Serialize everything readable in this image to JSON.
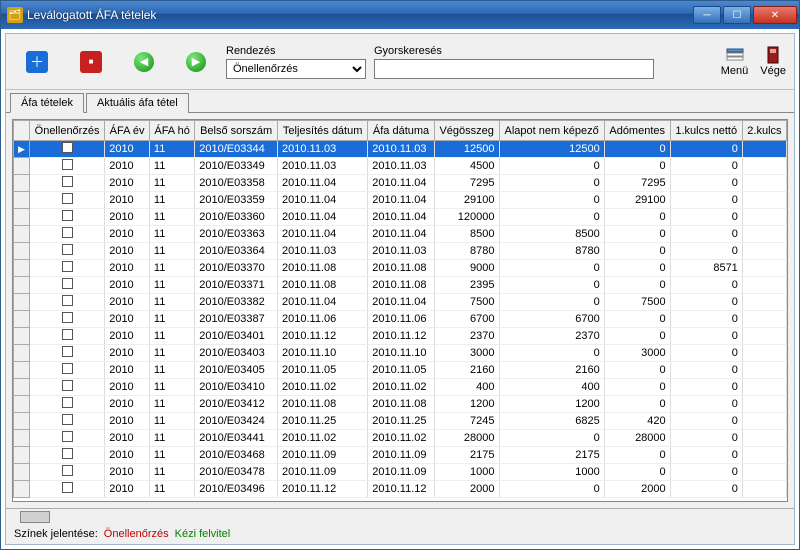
{
  "window": {
    "title": "Leválogatott ÁFA tételek"
  },
  "toolbar": {
    "sort_label": "Rendezés",
    "sort_value": "Önellenőrzés",
    "search_label": "Gyorskeresés",
    "search_value": "",
    "menu": "Menü",
    "end": "Vége"
  },
  "tabs": {
    "items": [
      "Áfa tételek",
      "Aktuális áfa tétel"
    ],
    "active": 0
  },
  "grid": {
    "columns": [
      "Önellenőrzés",
      "ÁFA év",
      "ÁFA hó",
      "Belső sorszám",
      "Teljesítés dátum",
      "Áfa dátuma",
      "Végösszeg",
      "Alapot nem képező",
      "Adómentes",
      "1.kulcs nettó",
      "2.kulcs"
    ],
    "rows": [
      {
        "sel": true,
        "ev": "2010",
        "ho": "11",
        "bs": "2010/E03344",
        "td": "2010.11.03",
        "ad": "2010.11.03",
        "vo": "12500",
        "ank": "12500",
        "am": "0",
        "k1": "0"
      },
      {
        "ev": "2010",
        "ho": "11",
        "bs": "2010/E03349",
        "td": "2010.11.03",
        "ad": "2010.11.03",
        "vo": "4500",
        "ank": "0",
        "am": "0",
        "k1": "0"
      },
      {
        "ev": "2010",
        "ho": "11",
        "bs": "2010/E03358",
        "td": "2010.11.04",
        "ad": "2010.11.04",
        "vo": "7295",
        "ank": "0",
        "am": "7295",
        "k1": "0"
      },
      {
        "ev": "2010",
        "ho": "11",
        "bs": "2010/E03359",
        "td": "2010.11.04",
        "ad": "2010.11.04",
        "vo": "29100",
        "ank": "0",
        "am": "29100",
        "k1": "0"
      },
      {
        "ev": "2010",
        "ho": "11",
        "bs": "2010/E03360",
        "td": "2010.11.04",
        "ad": "2010.11.04",
        "vo": "120000",
        "ank": "0",
        "am": "0",
        "k1": "0"
      },
      {
        "ev": "2010",
        "ho": "11",
        "bs": "2010/E03363",
        "td": "2010.11.04",
        "ad": "2010.11.04",
        "vo": "8500",
        "ank": "8500",
        "am": "0",
        "k1": "0"
      },
      {
        "ev": "2010",
        "ho": "11",
        "bs": "2010/E03364",
        "td": "2010.11.03",
        "ad": "2010.11.03",
        "vo": "8780",
        "ank": "8780",
        "am": "0",
        "k1": "0"
      },
      {
        "ev": "2010",
        "ho": "11",
        "bs": "2010/E03370",
        "td": "2010.11.08",
        "ad": "2010.11.08",
        "vo": "9000",
        "ank": "0",
        "am": "0",
        "k1": "8571"
      },
      {
        "ev": "2010",
        "ho": "11",
        "bs": "2010/E03371",
        "td": "2010.11.08",
        "ad": "2010.11.08",
        "vo": "2395",
        "ank": "0",
        "am": "0",
        "k1": "0"
      },
      {
        "ev": "2010",
        "ho": "11",
        "bs": "2010/E03382",
        "td": "2010.11.04",
        "ad": "2010.11.04",
        "vo": "7500",
        "ank": "0",
        "am": "7500",
        "k1": "0"
      },
      {
        "ev": "2010",
        "ho": "11",
        "bs": "2010/E03387",
        "td": "2010.11.06",
        "ad": "2010.11.06",
        "vo": "6700",
        "ank": "6700",
        "am": "0",
        "k1": "0"
      },
      {
        "ev": "2010",
        "ho": "11",
        "bs": "2010/E03401",
        "td": "2010.11.12",
        "ad": "2010.11.12",
        "vo": "2370",
        "ank": "2370",
        "am": "0",
        "k1": "0"
      },
      {
        "ev": "2010",
        "ho": "11",
        "bs": "2010/E03403",
        "td": "2010.11.10",
        "ad": "2010.11.10",
        "vo": "3000",
        "ank": "0",
        "am": "3000",
        "k1": "0"
      },
      {
        "ev": "2010",
        "ho": "11",
        "bs": "2010/E03405",
        "td": "2010.11.05",
        "ad": "2010.11.05",
        "vo": "2160",
        "ank": "2160",
        "am": "0",
        "k1": "0"
      },
      {
        "ev": "2010",
        "ho": "11",
        "bs": "2010/E03410",
        "td": "2010.11.02",
        "ad": "2010.11.02",
        "vo": "400",
        "ank": "400",
        "am": "0",
        "k1": "0"
      },
      {
        "ev": "2010",
        "ho": "11",
        "bs": "2010/E03412",
        "td": "2010.11.08",
        "ad": "2010.11.08",
        "vo": "1200",
        "ank": "1200",
        "am": "0",
        "k1": "0"
      },
      {
        "ev": "2010",
        "ho": "11",
        "bs": "2010/E03424",
        "td": "2010.11.25",
        "ad": "2010.11.25",
        "vo": "7245",
        "ank": "6825",
        "am": "420",
        "k1": "0"
      },
      {
        "ev": "2010",
        "ho": "11",
        "bs": "2010/E03441",
        "td": "2010.11.02",
        "ad": "2010.11.02",
        "vo": "28000",
        "ank": "0",
        "am": "28000",
        "k1": "0"
      },
      {
        "ev": "2010",
        "ho": "11",
        "bs": "2010/E03468",
        "td": "2010.11.09",
        "ad": "2010.11.09",
        "vo": "2175",
        "ank": "2175",
        "am": "0",
        "k1": "0"
      },
      {
        "ev": "2010",
        "ho": "11",
        "bs": "2010/E03478",
        "td": "2010.11.09",
        "ad": "2010.11.09",
        "vo": "1000",
        "ank": "1000",
        "am": "0",
        "k1": "0"
      },
      {
        "ev": "2010",
        "ho": "11",
        "bs": "2010/E03496",
        "td": "2010.11.12",
        "ad": "2010.11.12",
        "vo": "2000",
        "ank": "0",
        "am": "2000",
        "k1": "0"
      }
    ]
  },
  "legend": {
    "label": "Színek jelentése:",
    "red": "Önellenőrzés",
    "green": "Kézi felvitel"
  }
}
